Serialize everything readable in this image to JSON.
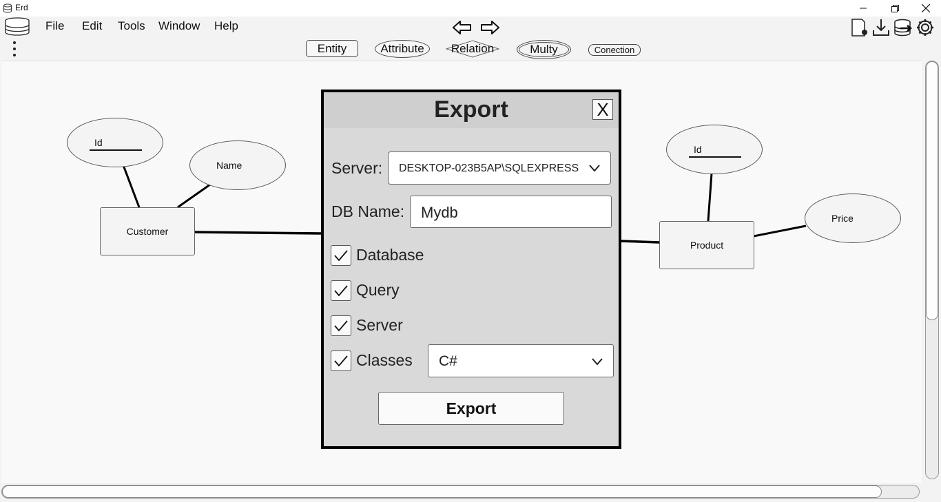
{
  "window": {
    "title": "Erd",
    "icons": {
      "app": "database-icon",
      "minimize": "minimize-icon",
      "restore": "restore-icon",
      "close": "close-icon"
    }
  },
  "menu": {
    "items": [
      "File",
      "Edit",
      "Tools",
      "Window",
      "Help"
    ],
    "more_icon": "more-vertical-icon",
    "undo_icon": "arrow-left-icon",
    "redo_icon": "arrow-right-icon"
  },
  "toolbar": {
    "entity": "Entity",
    "attribute": "Attribute",
    "relation": "Relation",
    "multy": "Multy",
    "connection": "Conection",
    "right_icons": [
      "new-document-icon",
      "download-icon",
      "database-export-icon",
      "settings-gear-icon"
    ]
  },
  "diagram": {
    "entities": [
      {
        "name": "Customer",
        "attributes": [
          {
            "name": "Id",
            "key": true
          },
          {
            "name": "Name",
            "key": false
          }
        ]
      },
      {
        "name": "Product",
        "attributes": [
          {
            "name": "Id",
            "key": true
          },
          {
            "name": "Price",
            "key": false
          }
        ]
      }
    ]
  },
  "export_dialog": {
    "title": "Export",
    "close_label": "X",
    "server_label": "Server:",
    "server_value": "DESKTOP-023B5AP\\SQLEXPRESS",
    "dbname_label": "DB Name:",
    "dbname_value": "Mydb",
    "checkboxes": [
      {
        "label": "Database",
        "checked": true
      },
      {
        "label": "Query",
        "checked": true
      },
      {
        "label": "Server",
        "checked": true
      },
      {
        "label": "Classes",
        "checked": true
      }
    ],
    "language_value": "C#",
    "export_button": "Export"
  }
}
